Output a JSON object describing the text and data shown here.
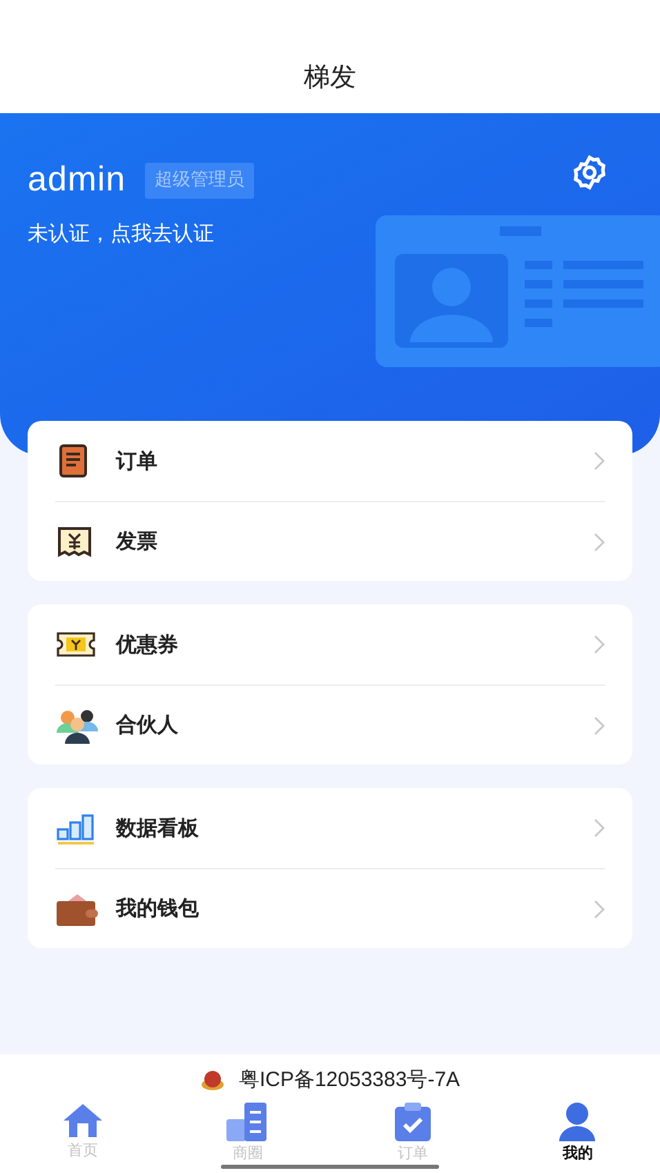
{
  "header": {
    "title": "梯发"
  },
  "profile": {
    "name": "admin",
    "role": "超级管理员",
    "verify_link": "未认证，点我去认证"
  },
  "menu_groups": [
    {
      "items": [
        {
          "kind": "order",
          "label": "订单"
        },
        {
          "kind": "invoice",
          "label": "发票"
        }
      ]
    },
    {
      "items": [
        {
          "kind": "coupon",
          "label": "优惠券"
        },
        {
          "kind": "partner",
          "label": "合伙人"
        }
      ]
    },
    {
      "items": [
        {
          "kind": "dashboard",
          "label": "数据看板"
        },
        {
          "kind": "wallet",
          "label": "我的钱包"
        }
      ]
    }
  ],
  "footer": {
    "icp": "粤ICP备12053383号-7A"
  },
  "tabs": [
    {
      "kind": "home",
      "label": "首页",
      "selected": false
    },
    {
      "kind": "business",
      "label": "商圈",
      "selected": false
    },
    {
      "kind": "orders",
      "label": "订单",
      "selected": false
    },
    {
      "kind": "mine",
      "label": "我的",
      "selected": true
    }
  ]
}
